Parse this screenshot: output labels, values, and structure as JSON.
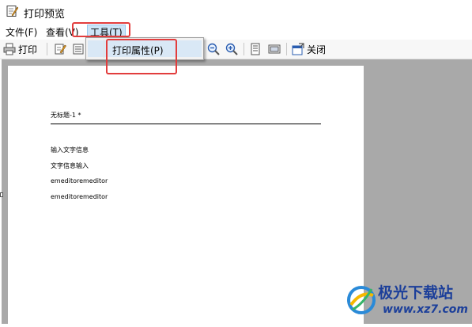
{
  "window": {
    "title": "打印预览"
  },
  "menubar": {
    "items": [
      {
        "label": "文件(F)"
      },
      {
        "label": "查看(V)"
      },
      {
        "label": "工具(T)"
      }
    ]
  },
  "toolbar": {
    "print_label": "打印",
    "close_label": "关闭"
  },
  "tools_menu": {
    "print_properties_label": "打印属性(P)"
  },
  "document": {
    "header": "无标题-1 *",
    "lines": [
      "输入文字信息",
      "文字信息输入",
      "emeditoremeditor",
      "emeditoremeditor"
    ]
  },
  "watermark": {
    "name": "极光下载站",
    "url": "www.xz7.com"
  },
  "colors": {
    "highlight": "#e23d3d",
    "preview_background": "#a9a9a9",
    "menu_active": "#cce4f7",
    "watermark": "#1c3f9a"
  }
}
